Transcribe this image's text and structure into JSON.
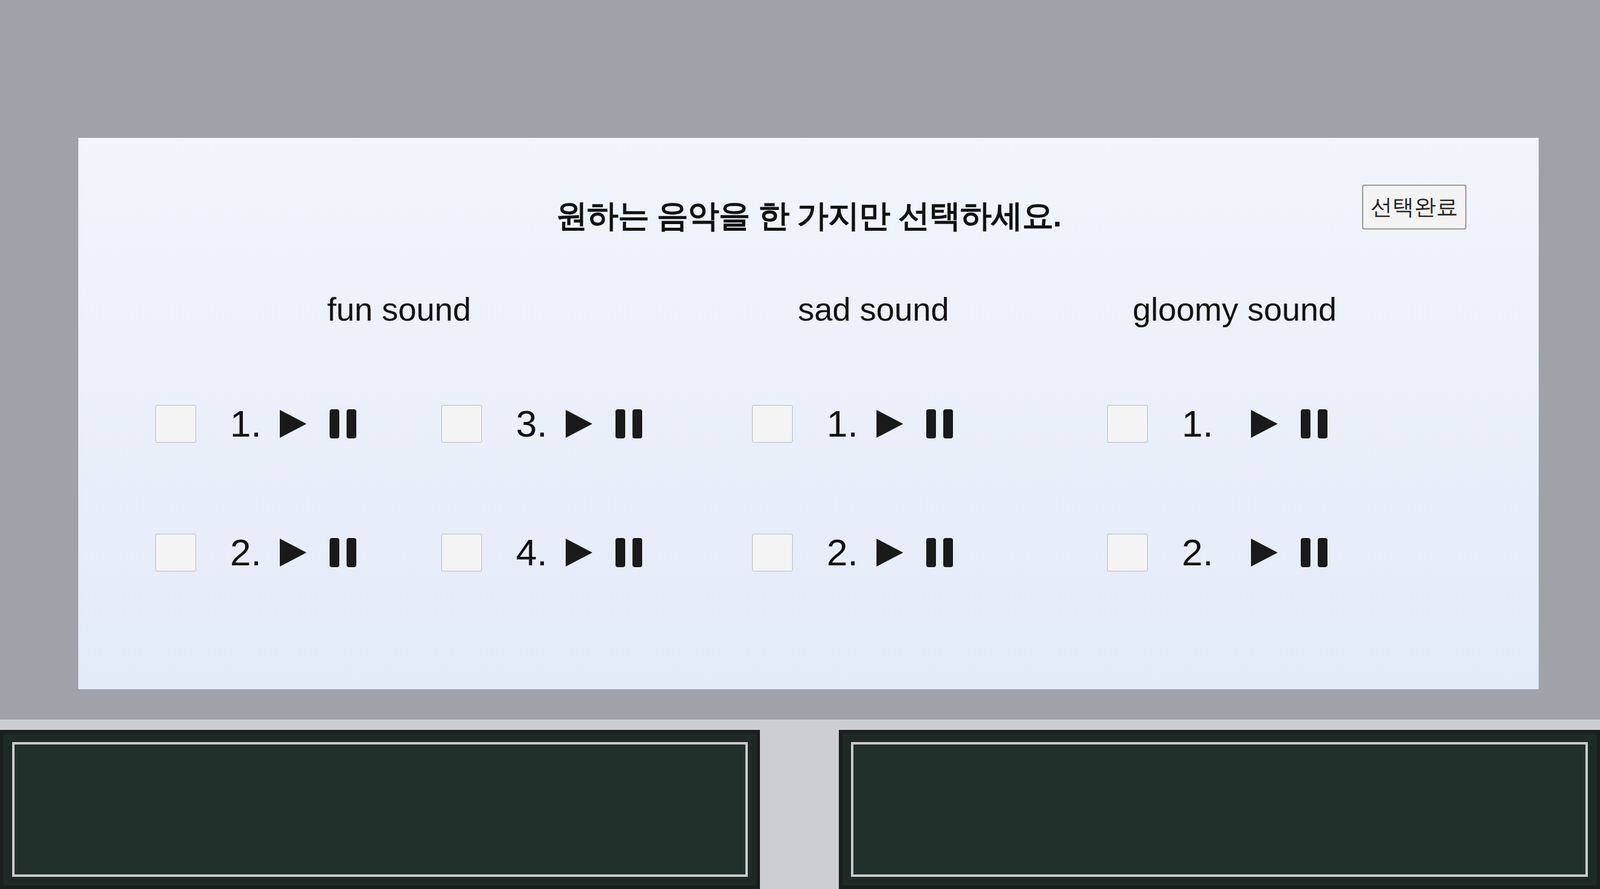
{
  "panel": {
    "title": "원하는 음악을 한 가지만 선택하세요.",
    "button": "선택완료"
  },
  "sections": [
    {
      "name": "fun sound",
      "tracks": [
        {
          "number": "1.",
          "checked": false
        },
        {
          "number": "2.",
          "checked": false
        },
        {
          "number": "3.",
          "checked": false
        },
        {
          "number": "4.",
          "checked": false
        }
      ]
    },
    {
      "name": "sad sound",
      "tracks": [
        {
          "number": "1.",
          "checked": false
        },
        {
          "number": "2.",
          "checked": false
        }
      ]
    },
    {
      "name": "gloomy sound",
      "tracks": [
        {
          "number": "1.",
          "checked": false
        },
        {
          "number": "2.",
          "checked": false
        }
      ]
    }
  ]
}
